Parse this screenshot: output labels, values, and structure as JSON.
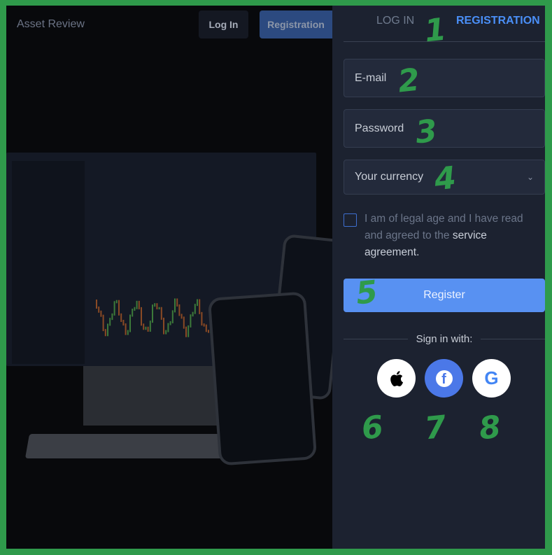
{
  "header": {
    "brand": "Asset Review",
    "login_button": "Log In",
    "registration_button": "Registration"
  },
  "panel": {
    "tabs": [
      {
        "label": "LOG IN",
        "active": false
      },
      {
        "label": "REGISTRATION",
        "active": true
      }
    ],
    "email_placeholder": "E-mail",
    "password_placeholder": "Password",
    "currency_placeholder": "Your currency",
    "terms_text": "I am of legal age and I have read and agreed to the ",
    "terms_link": "service agreement",
    "terms_end": ".",
    "register_button": "Register",
    "sign_in_with": "Sign in with:",
    "social": [
      {
        "icon": "apple-icon"
      },
      {
        "icon": "facebook-icon",
        "glyph": "f"
      },
      {
        "icon": "google-icon",
        "glyph": "G"
      }
    ]
  },
  "annotations": [
    "1",
    "2",
    "3",
    "4",
    "5",
    "6",
    "7",
    "8"
  ],
  "colors": {
    "accent": "#4a8ff7",
    "button": "#5891f2",
    "panel": "#1c2230",
    "annotation": "#2f9a4b"
  }
}
